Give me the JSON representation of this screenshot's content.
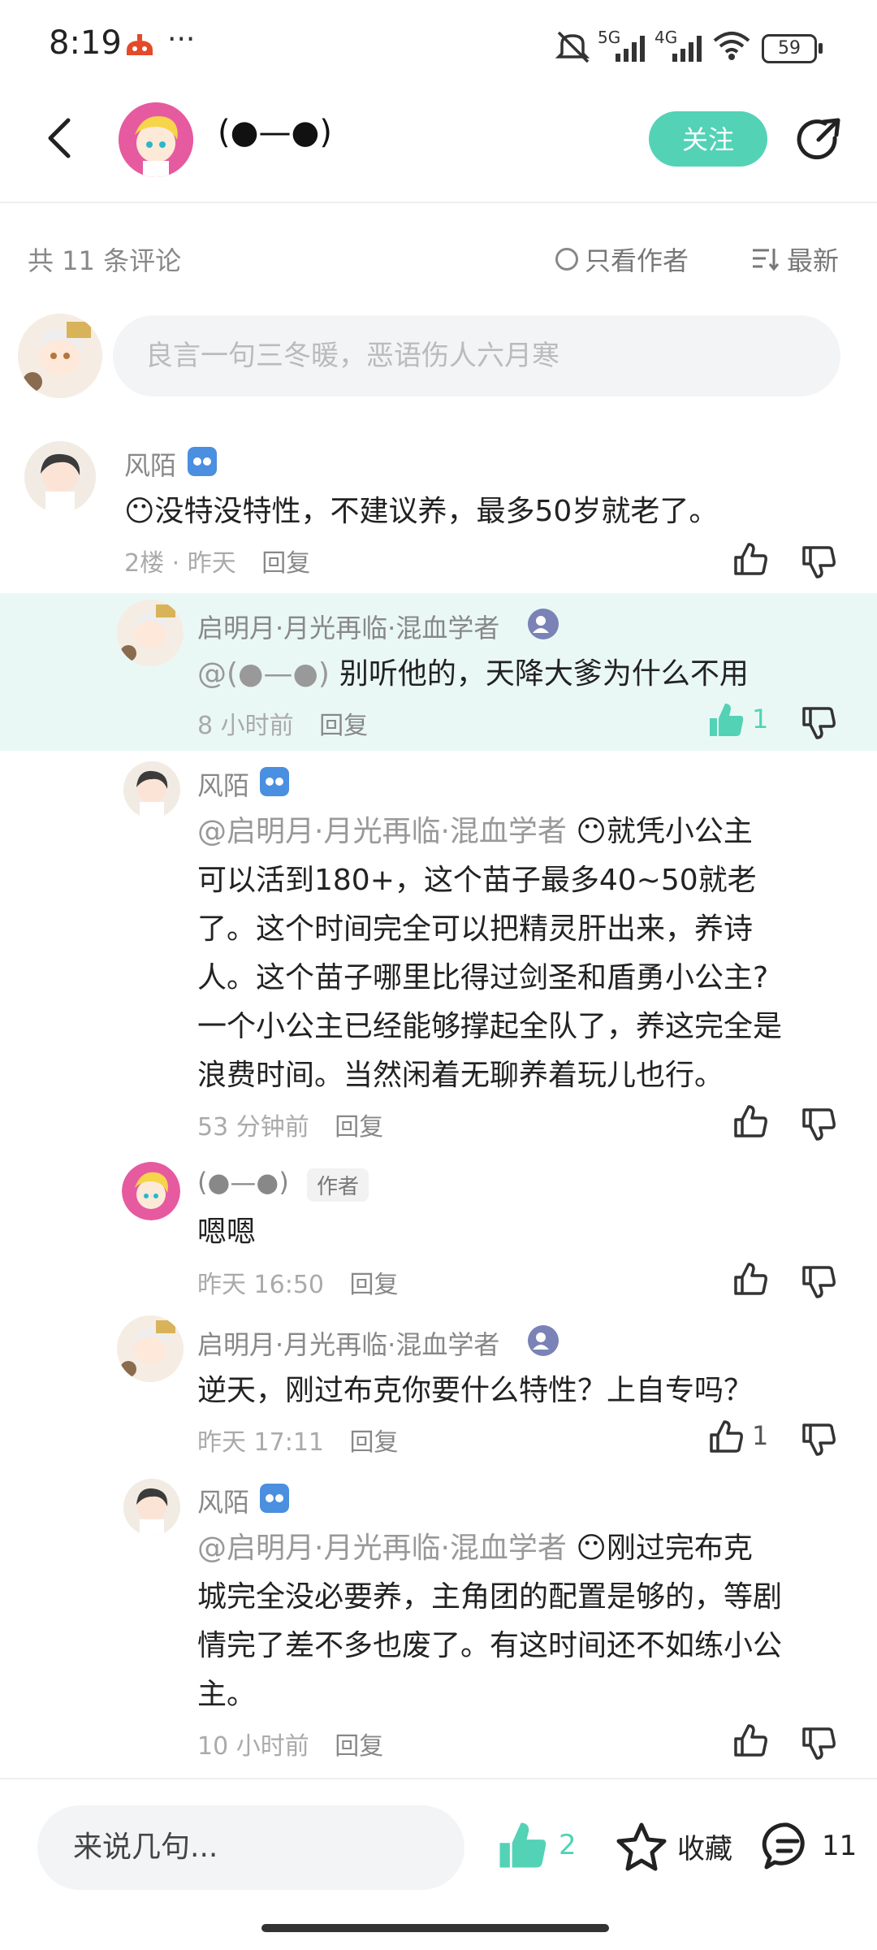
{
  "status_bar": {
    "time": "8:19",
    "dots": "···",
    "net1": "5G",
    "net2": "4G",
    "battery": "59"
  },
  "header": {
    "author_name": "(●—●)",
    "follow_label": "关注"
  },
  "filter": {
    "count_label": "共 11 条评论",
    "only_author_label": "只看作者",
    "sort_label": "最新"
  },
  "comment_input": {
    "placeholder": "良言一句三冬暖，恶语伤人六月寒"
  },
  "comments": [
    {
      "user": "风陌",
      "text": "没特没特性，不建议养，最多50岁就老了。",
      "floor": "2楼",
      "sep": "·",
      "time": "昨天",
      "reply_label": "回复"
    },
    {
      "user": "启明月·月光再临·混血学者",
      "mention": "@(●—●)",
      "text": "别听他的，天降大爹为什么不用",
      "time": "8 小时前",
      "reply_label": "回复",
      "likes": "1"
    },
    {
      "user": "风陌",
      "mention": "@启明月·月光再临·混血学者",
      "text_first": "就凭小公主",
      "text_rest": [
        "可以活到180+，这个苗子最多40~50就老",
        "了。这个时间完全可以把精灵肝出来，养诗",
        "人。这个苗子哪里比得过剑圣和盾勇小公主?",
        "一个小公主已经能够撑起全队了，养这完全是",
        "浪费时间。当然闲着无聊养着玩儿也行。"
      ],
      "time": "53 分钟前",
      "reply_label": "回复"
    },
    {
      "user": "(●—●)",
      "author_tag": "作者",
      "text": "嗯嗯",
      "time": "昨天 16:50",
      "reply_label": "回复"
    },
    {
      "user": "启明月·月光再临·混血学者",
      "text": "逆天，刚过布克你要什么特性？上自专吗？",
      "time": "昨天 17:11",
      "reply_label": "回复",
      "likes": "1"
    },
    {
      "user": "风陌",
      "mention": "@启明月·月光再临·混血学者",
      "text_first": "刚过完布克",
      "text_rest": [
        "城完全没必要养，主角团的配置是够的，等剧",
        "情完了差不多也废了。有这时间还不如练小公",
        "主。"
      ],
      "time": "10 小时前",
      "reply_label": "回复"
    }
  ],
  "bottom_bar": {
    "input_placeholder": "来说几句...",
    "like_count": "2",
    "favorite_label": "收藏",
    "comment_count": "11"
  }
}
